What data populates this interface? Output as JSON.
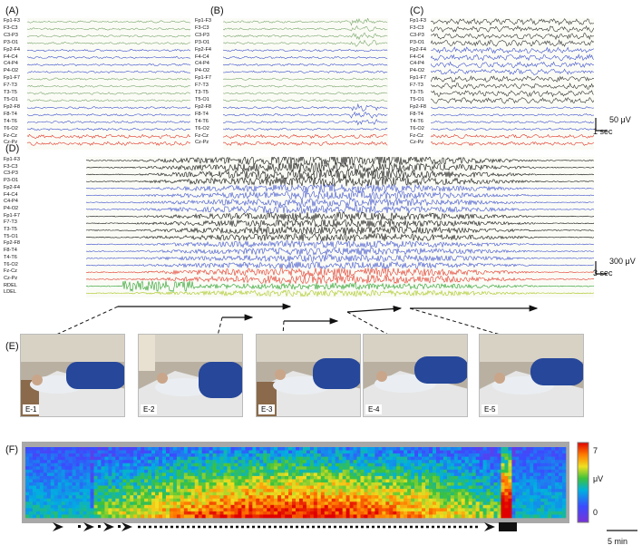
{
  "panels": {
    "a": "(A)",
    "b": "(B)",
    "c": "(C)",
    "d": "(D)",
    "e": "(E)",
    "f": "(F)"
  },
  "channels_small": [
    "Fp1-F3",
    "F3-C3",
    "C3-P3",
    "P3-O1",
    "Fp2-F4",
    "F4-C4",
    "C4-P4",
    "P4-O2",
    "Fp1-F7",
    "F7-T3",
    "T3-T5",
    "T5-O1",
    "Fp2-F8",
    "F8-T4",
    "T4-T6",
    "T6-O2",
    "Fz-Cz",
    "Cz-Pz"
  ],
  "channels_d": [
    "Fp1-F3",
    "F3-C3",
    "C3-P3",
    "P3-O1",
    "Fp2-F4",
    "F4-C4",
    "C4-P4",
    "P4-O2",
    "Fp1-F7",
    "F7-T3",
    "T3-T5",
    "T5-O1",
    "Fp2-F8",
    "F8-T4",
    "T4-T6",
    "T6-O2",
    "Fz-Cz",
    "Cz-Pz",
    "RDEL",
    "LDEL"
  ],
  "scales": {
    "abc_amp": "50 μV",
    "abc_time": "1 sec",
    "d_amp": "300 μV",
    "d_time": "3 sec",
    "f_time": "5 min"
  },
  "photos": [
    "E-1",
    "E-2",
    "E-3",
    "E-4",
    "E-5"
  ],
  "colorbar": {
    "max": "7",
    "unit": "μV",
    "min": "0"
  },
  "colors": {
    "green": "#7aa86e",
    "blue": "#4055cc",
    "red": "#e23a2a",
    "black": "#111111",
    "lime": "#a8c820",
    "background": "#fbfbf6"
  }
}
